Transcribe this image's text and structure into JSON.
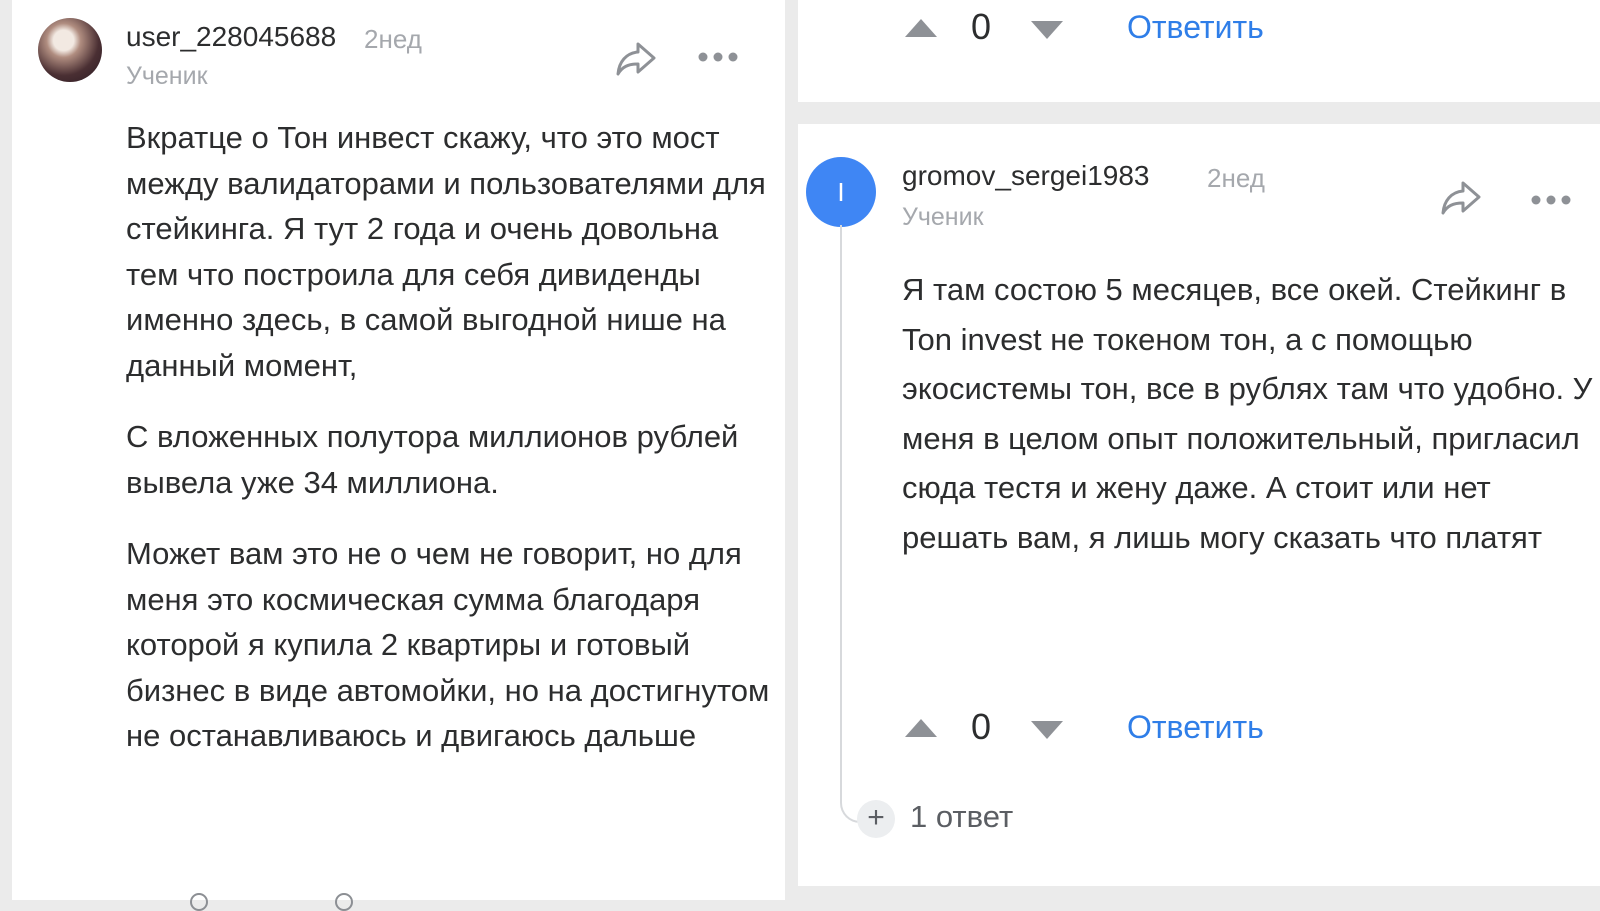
{
  "left_comment": {
    "username": "user_228045688",
    "time": "2нед",
    "role": "Ученик",
    "paragraphs": [
      "Вкратце о Тон инвест скажу, что это мост между валидаторами и пользователями для стейкинга. Я тут 2 года и очень довольна тем что построила для себя дивиденды именно здесь, в самой выгодной нише на данный момент,",
      "С вложенных полутора миллионов рублей вывела уже 34 миллиона.",
      "Может вам это не о чем не говорит, но для меня это космическая сумма благодаря которой я купила 2 квартиры и готовый бизнес в виде автомойки, но на достигнутом не останавливаюсь и двигаюсь дальше"
    ]
  },
  "top_actions": {
    "score": "0",
    "reply_label": "Ответить"
  },
  "right_comment": {
    "avatar_letter": "I",
    "username": "gromov_sergei1983",
    "time": "2нед",
    "role": "Ученик",
    "text": "Я там состою 5 месяцев, все окей. Стейкинг в Ton invest не токеном тон, а с помощью экосистемы тон, все в рублях там что удобно. У меня в целом опыт положительный, пригласил сюда тестя и жену даже. А стоит или нет решать вам, я лишь могу сказать что платят",
    "score": "0",
    "reply_label": "Ответить",
    "replies_label": "1 ответ"
  },
  "icons": {
    "share": "share-arrow-icon",
    "more": "more-dots-icon",
    "upvote": "upvote-triangle-icon",
    "downvote": "downvote-triangle-icon",
    "expand": "plus-icon"
  },
  "colors": {
    "link": "#2f7ee8",
    "avatar": "#3f86f4",
    "muted": "#a5a8ad",
    "text": "#2c2d2e",
    "background": "#ebebeb"
  }
}
